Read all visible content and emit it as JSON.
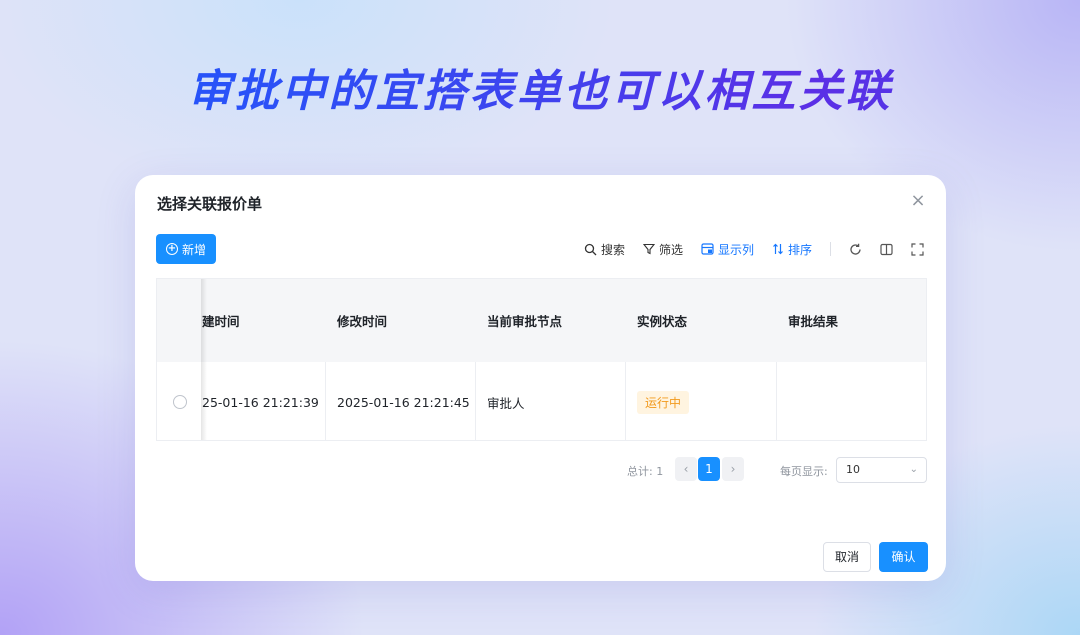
{
  "headline": "审批中的宜搭表单也可以相互关联",
  "dialog": {
    "title": "选择关联报价单",
    "close_icon": "×",
    "new_button": "新增",
    "toolbar": {
      "search": "搜索",
      "filter": "筛选",
      "columns": "显示列",
      "sort": "排序",
      "icons": {
        "search": "search-icon",
        "filter": "filter-icon",
        "columns": "columns-icon",
        "sort": "sort-icon",
        "refresh": "refresh-icon",
        "split": "split-view-icon",
        "fullscreen": "fullscreen-icon"
      }
    },
    "table": {
      "headers": [
        "建时间",
        "修改时间",
        "当前审批节点",
        "实例状态",
        "审批结果"
      ],
      "rows": [
        {
          "created": "25-01-16 21:21:39",
          "modified": "2025-01-16 21:21:45",
          "node": "审批人",
          "status": "运行中",
          "result": ""
        }
      ]
    },
    "pagination": {
      "total": "总计: 1",
      "prev": "‹",
      "page": "1",
      "next": "›",
      "per_page_label": "每页显示:",
      "per_page_value": "10"
    },
    "cancel": "取消",
    "confirm": "确认"
  },
  "colors": {
    "primary": "#1890ff",
    "status_tag_text": "#f29a1d",
    "status_tag_bg": "#fff4e0"
  }
}
